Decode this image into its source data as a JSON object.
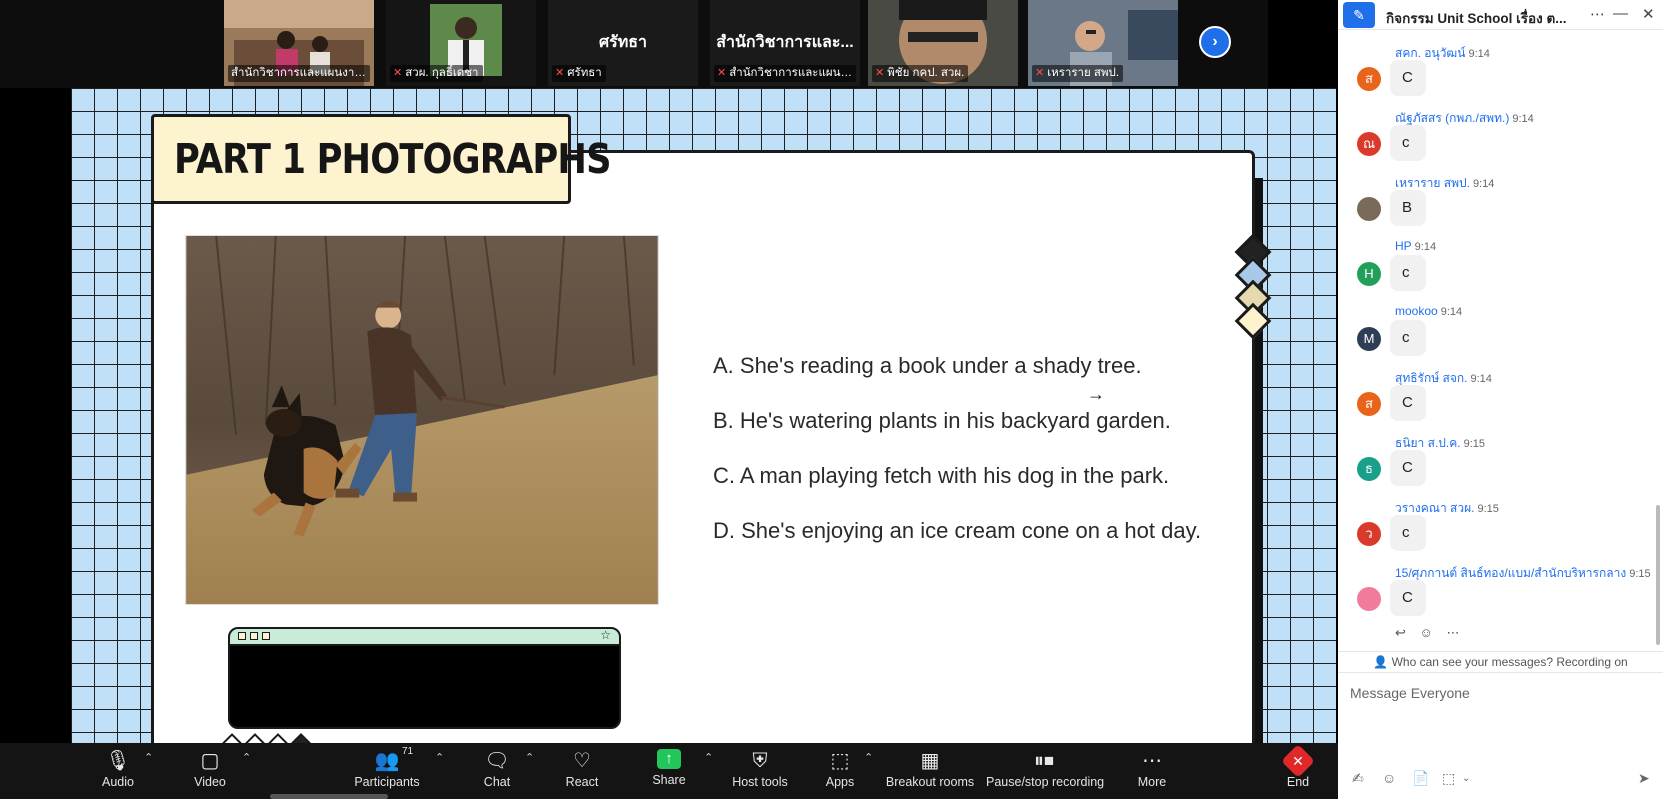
{
  "video_strip": {
    "tiles": [
      {
        "name": "สำนักวิชาการและแผนงาน (สุ...",
        "muted": false,
        "active": true,
        "big_name": ""
      },
      {
        "name": "สวผ. กุลธิ์เดชา",
        "muted": true,
        "active": false,
        "big_name": ""
      },
      {
        "name": "ศรัทธา",
        "muted": true,
        "active": false,
        "big_name": "ศรัทธา"
      },
      {
        "name": "สำนักวิชาการและแผนงาน...",
        "muted": true,
        "active": false,
        "big_name": "สำนักวิชาการและ..."
      },
      {
        "name": "พิชัย กคป. สวผ.",
        "muted": true,
        "active": false,
        "big_name": ""
      },
      {
        "name": "เหราราย สพป.",
        "muted": true,
        "active": false,
        "big_name": ""
      }
    ],
    "next_icon": "chevron-right-icon"
  },
  "slide": {
    "title": "PART 1 PHOTOGRAPHS",
    "options": [
      "A. She's reading a book under a shady tree.",
      "B. He's watering plants in his backyard garden.",
      "C. A man playing fetch with his dog in the park.",
      "D. She's enjoying an ice cream cone on a hot day."
    ],
    "colors": {
      "grid_bg": "#bfe0f7",
      "title_bg": "#fdf3cf",
      "diamonds": [
        "#222222",
        "#a9c9e8",
        "#e5d9b0",
        "#fdf3cf"
      ]
    }
  },
  "toolbar": {
    "audio": "Audio",
    "video": "Video",
    "participants": "Participants",
    "participants_count": "71",
    "chat": "Chat",
    "react": "React",
    "share": "Share",
    "host_tools": "Host tools",
    "apps": "Apps",
    "breakout_rooms": "Breakout rooms",
    "pause_stop": "Pause/stop recording",
    "more": "More",
    "end": "End"
  },
  "chat": {
    "title": "กิจกรรม Unit School เรื่อง ต...",
    "messages": [
      {
        "sender": "สคก. อนุวัฒน์",
        "time": "9:14",
        "text": "C",
        "initial": "ส",
        "color": "#e8641b"
      },
      {
        "sender": "ณัฐภัสสร (กพภ./สพท.)",
        "time": "9:14",
        "text": "c",
        "initial": "ณ",
        "color": "#d93a2b"
      },
      {
        "sender": "เหราราย สพป.",
        "time": "9:14",
        "text": "B",
        "initial": "",
        "color": "#7a6a5a"
      },
      {
        "sender": "HP",
        "time": "9:14",
        "text": "c",
        "initial": "H",
        "color": "#22a05a"
      },
      {
        "sender": "mookoo",
        "time": "9:14",
        "text": "c",
        "initial": "M",
        "color": "#2f3e57"
      },
      {
        "sender": "สุทธิรักษ์ สจก.",
        "time": "9:14",
        "text": "C",
        "initial": "ส",
        "color": "#e8641b"
      },
      {
        "sender": "ธนิยา ส.ป.ค.",
        "time": "9:15",
        "text": "C",
        "initial": "ธ",
        "color": "#1aa08a"
      },
      {
        "sender": "วรางคณา สวผ.",
        "time": "9:15",
        "text": "c",
        "initial": "ว",
        "color": "#d93a2b"
      },
      {
        "sender": "15/ศุภกานต์ สินธ์ทอง/แบม/สำนักบริหารกลาง",
        "time": "9:15",
        "text": "C",
        "initial": "",
        "color": "#f27b9c"
      }
    ],
    "privacy_note": "Who can see your messages? Recording on",
    "input_placeholder": "Message Everyone"
  }
}
